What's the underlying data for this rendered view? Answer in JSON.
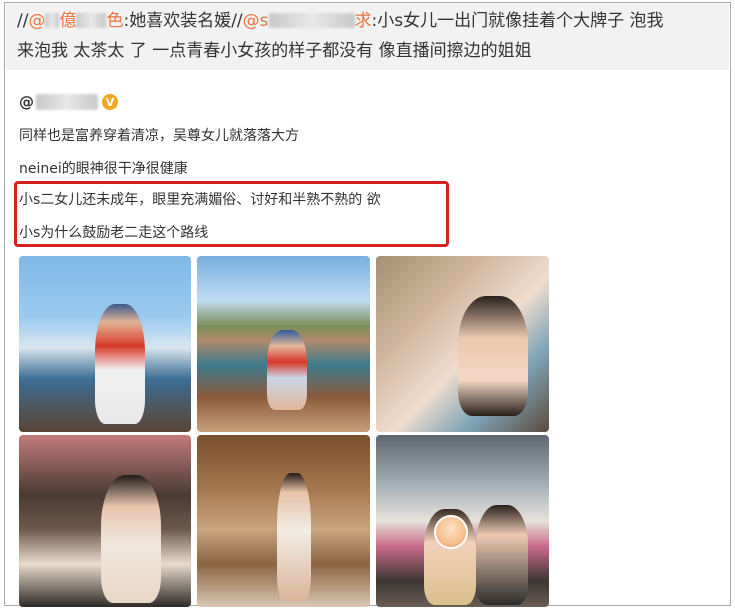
{
  "repost": {
    "line1_prefix": "//",
    "mention1_at": "@",
    "mention1_visible": "億",
    "mention1_tail": "色",
    "line1_mid": ":她喜欢装名媛//",
    "mention2_at": "@s",
    "mention2_tail": "求",
    "line1_end": ":小s女儿一出门就像挂着个大牌子 泡我",
    "line2": "来泡我 太茶太   了 一点青春小女孩的样子都没有 像直播间擦边的姐姐"
  },
  "post": {
    "at": "@",
    "verified_badge": "V",
    "lines": [
      "同样也是富养穿着清凉，吴尊女儿就落落大方",
      "neinei的眼神很干净很健康",
      "小s二女儿还未成年，眼里充满媚俗、讨好和半熟不熟的  欲",
      "小s为什么鼓励老二走这个路线"
    ]
  },
  "colors": {
    "mention": "#eb7340",
    "highlight_border": "#d42020",
    "repost_bg": "#f2f2f2",
    "verified": "#f5a623"
  },
  "photos": [
    {
      "name": "photo-1"
    },
    {
      "name": "photo-2"
    },
    {
      "name": "photo-3"
    },
    {
      "name": "photo-4"
    },
    {
      "name": "photo-5"
    },
    {
      "name": "photo-6"
    }
  ]
}
